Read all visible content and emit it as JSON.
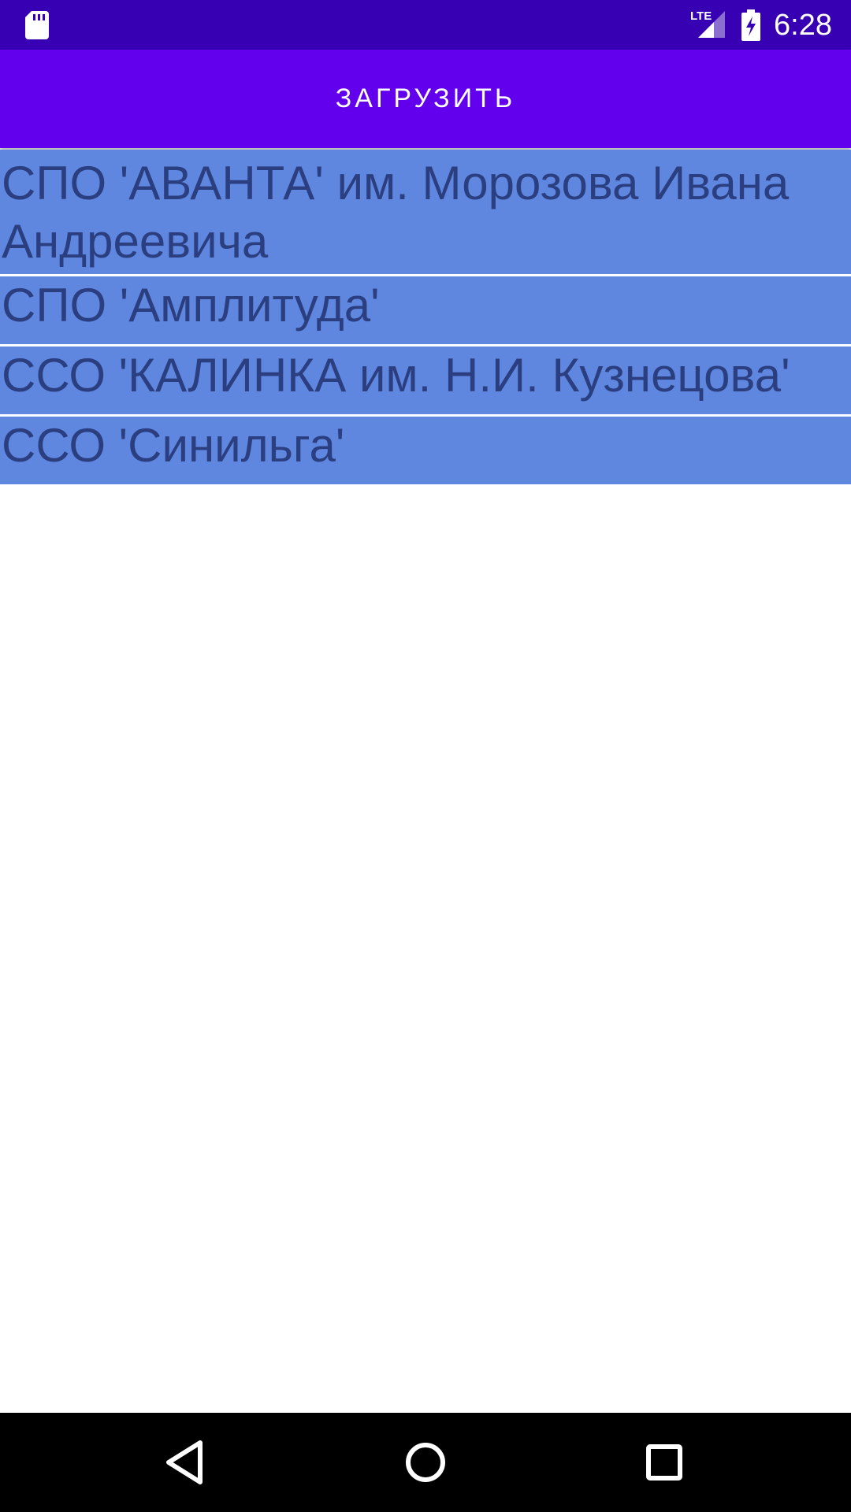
{
  "status_bar": {
    "time": "6:28",
    "network_label": "LTE",
    "background_color": "#3700b3",
    "icons": [
      "sd-card-icon",
      "lte-signal-icon",
      "battery-charging-icon"
    ]
  },
  "toolbar": {
    "load_label": "ЗАГРУЗИТЬ",
    "button_color": "#6200ee"
  },
  "list": {
    "item_color": "#5f87e0",
    "text_color": "#2b3f80",
    "items": [
      {
        "label": "СПО 'АВАНТА' им. Морозова Ивана Андреевича"
      },
      {
        "label": "СПО 'Амплитуда'"
      },
      {
        "label": "ССО 'КАЛИНКА им. Н.И. Кузнецова'"
      },
      {
        "label": "ССО 'Синильга'"
      }
    ]
  },
  "nav_bar": {
    "icons": [
      "back-icon",
      "home-icon",
      "recents-icon"
    ]
  }
}
